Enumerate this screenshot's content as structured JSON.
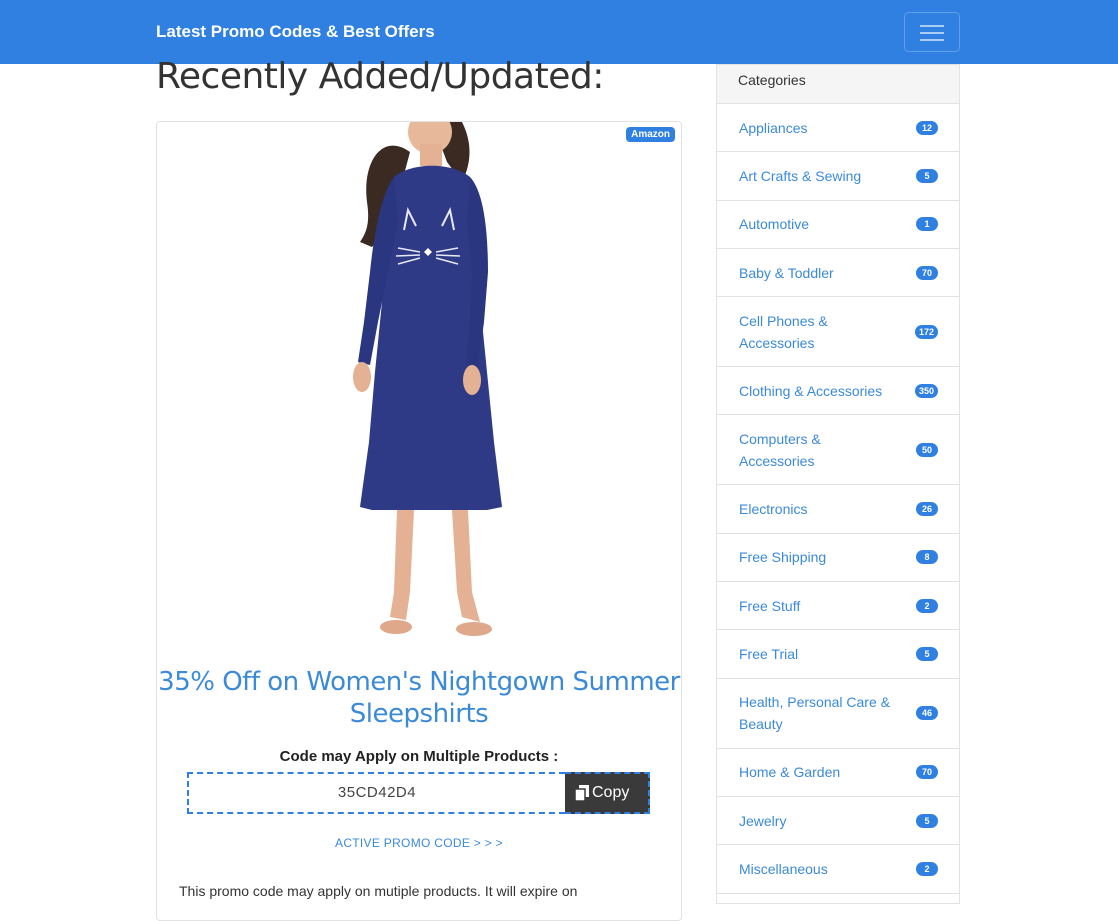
{
  "navbar": {
    "brand": "Latest Promo Codes & Best Offers",
    "toggle_icon": "hamburger-menu-icon"
  },
  "main": {
    "page_title": "Recently Added/Updated:",
    "offer": {
      "store_badge": "Amazon",
      "image": "product-photo-navy-cat-nightgown",
      "title": "35% Off on Women's Nightgown Summer Sleepshirts",
      "apply_note": "Code may Apply on Multiple Products :",
      "code": "35CD42D4",
      "copy_label": "Copy",
      "copy_icon": "copy-icon",
      "active_link": "ACTIVE PROMO CODE > > >",
      "description": "This promo code may apply on mutiple products. It will expire on"
    }
  },
  "sidebar": {
    "header": "Categories",
    "categories": [
      {
        "label": "Appliances",
        "count": "12"
      },
      {
        "label": "Art Crafts & Sewing",
        "count": "5"
      },
      {
        "label": "Automotive",
        "count": "1"
      },
      {
        "label": "Baby & Toddler",
        "count": "70"
      },
      {
        "label": "Cell Phones & Accessories",
        "count": "172"
      },
      {
        "label": "Clothing & Accessories",
        "count": "350"
      },
      {
        "label": "Computers & Accessories",
        "count": "50"
      },
      {
        "label": "Electronics",
        "count": "26"
      },
      {
        "label": "Free Shipping",
        "count": "8"
      },
      {
        "label": "Free Stuff",
        "count": "2"
      },
      {
        "label": "Free Trial",
        "count": "5"
      },
      {
        "label": "Health, Personal Care & Beauty",
        "count": "46"
      },
      {
        "label": "Home & Garden",
        "count": "70"
      },
      {
        "label": "Jewelry",
        "count": "5"
      },
      {
        "label": "Miscellaneous",
        "count": "2"
      }
    ]
  },
  "colors": {
    "brand_blue": "#2f80e0",
    "link_blue": "#3b8ad9",
    "copy_button": "#3a3a3a"
  }
}
